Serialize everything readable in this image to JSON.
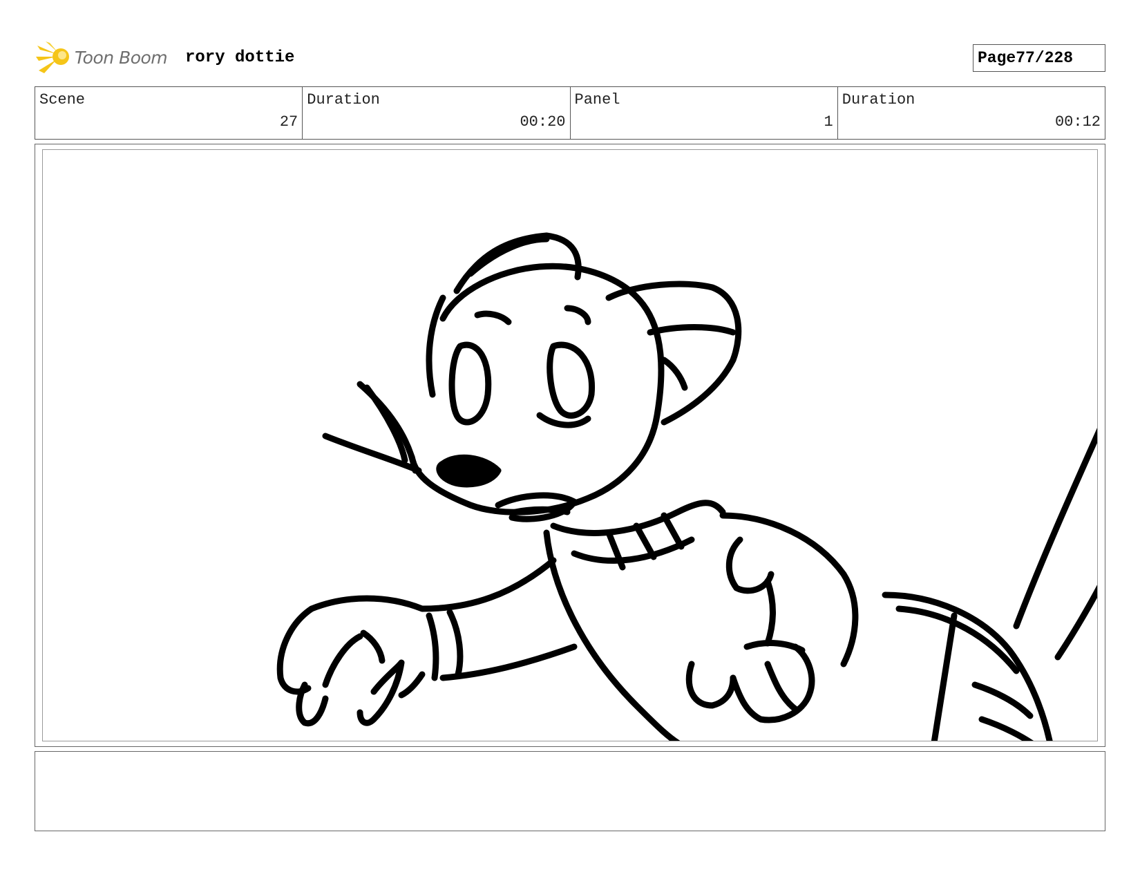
{
  "header": {
    "logo_text": "Toon Boom",
    "project_title": "rory dottie",
    "page_label": "Page",
    "page_number": "77/228"
  },
  "info": {
    "scene_label": "Scene",
    "scene_value": "27",
    "scene_duration_label": "Duration",
    "scene_duration_value": "00:20",
    "panel_label": "Panel",
    "panel_value": "1",
    "panel_duration_label": "Duration",
    "panel_duration_value": "00:12"
  },
  "notes": {
    "text": ""
  },
  "colors": {
    "logo_star": "#f5c518",
    "logo_text": "#6e6e6e"
  },
  "icons": {
    "logo": "toon-boom-star-icon"
  }
}
